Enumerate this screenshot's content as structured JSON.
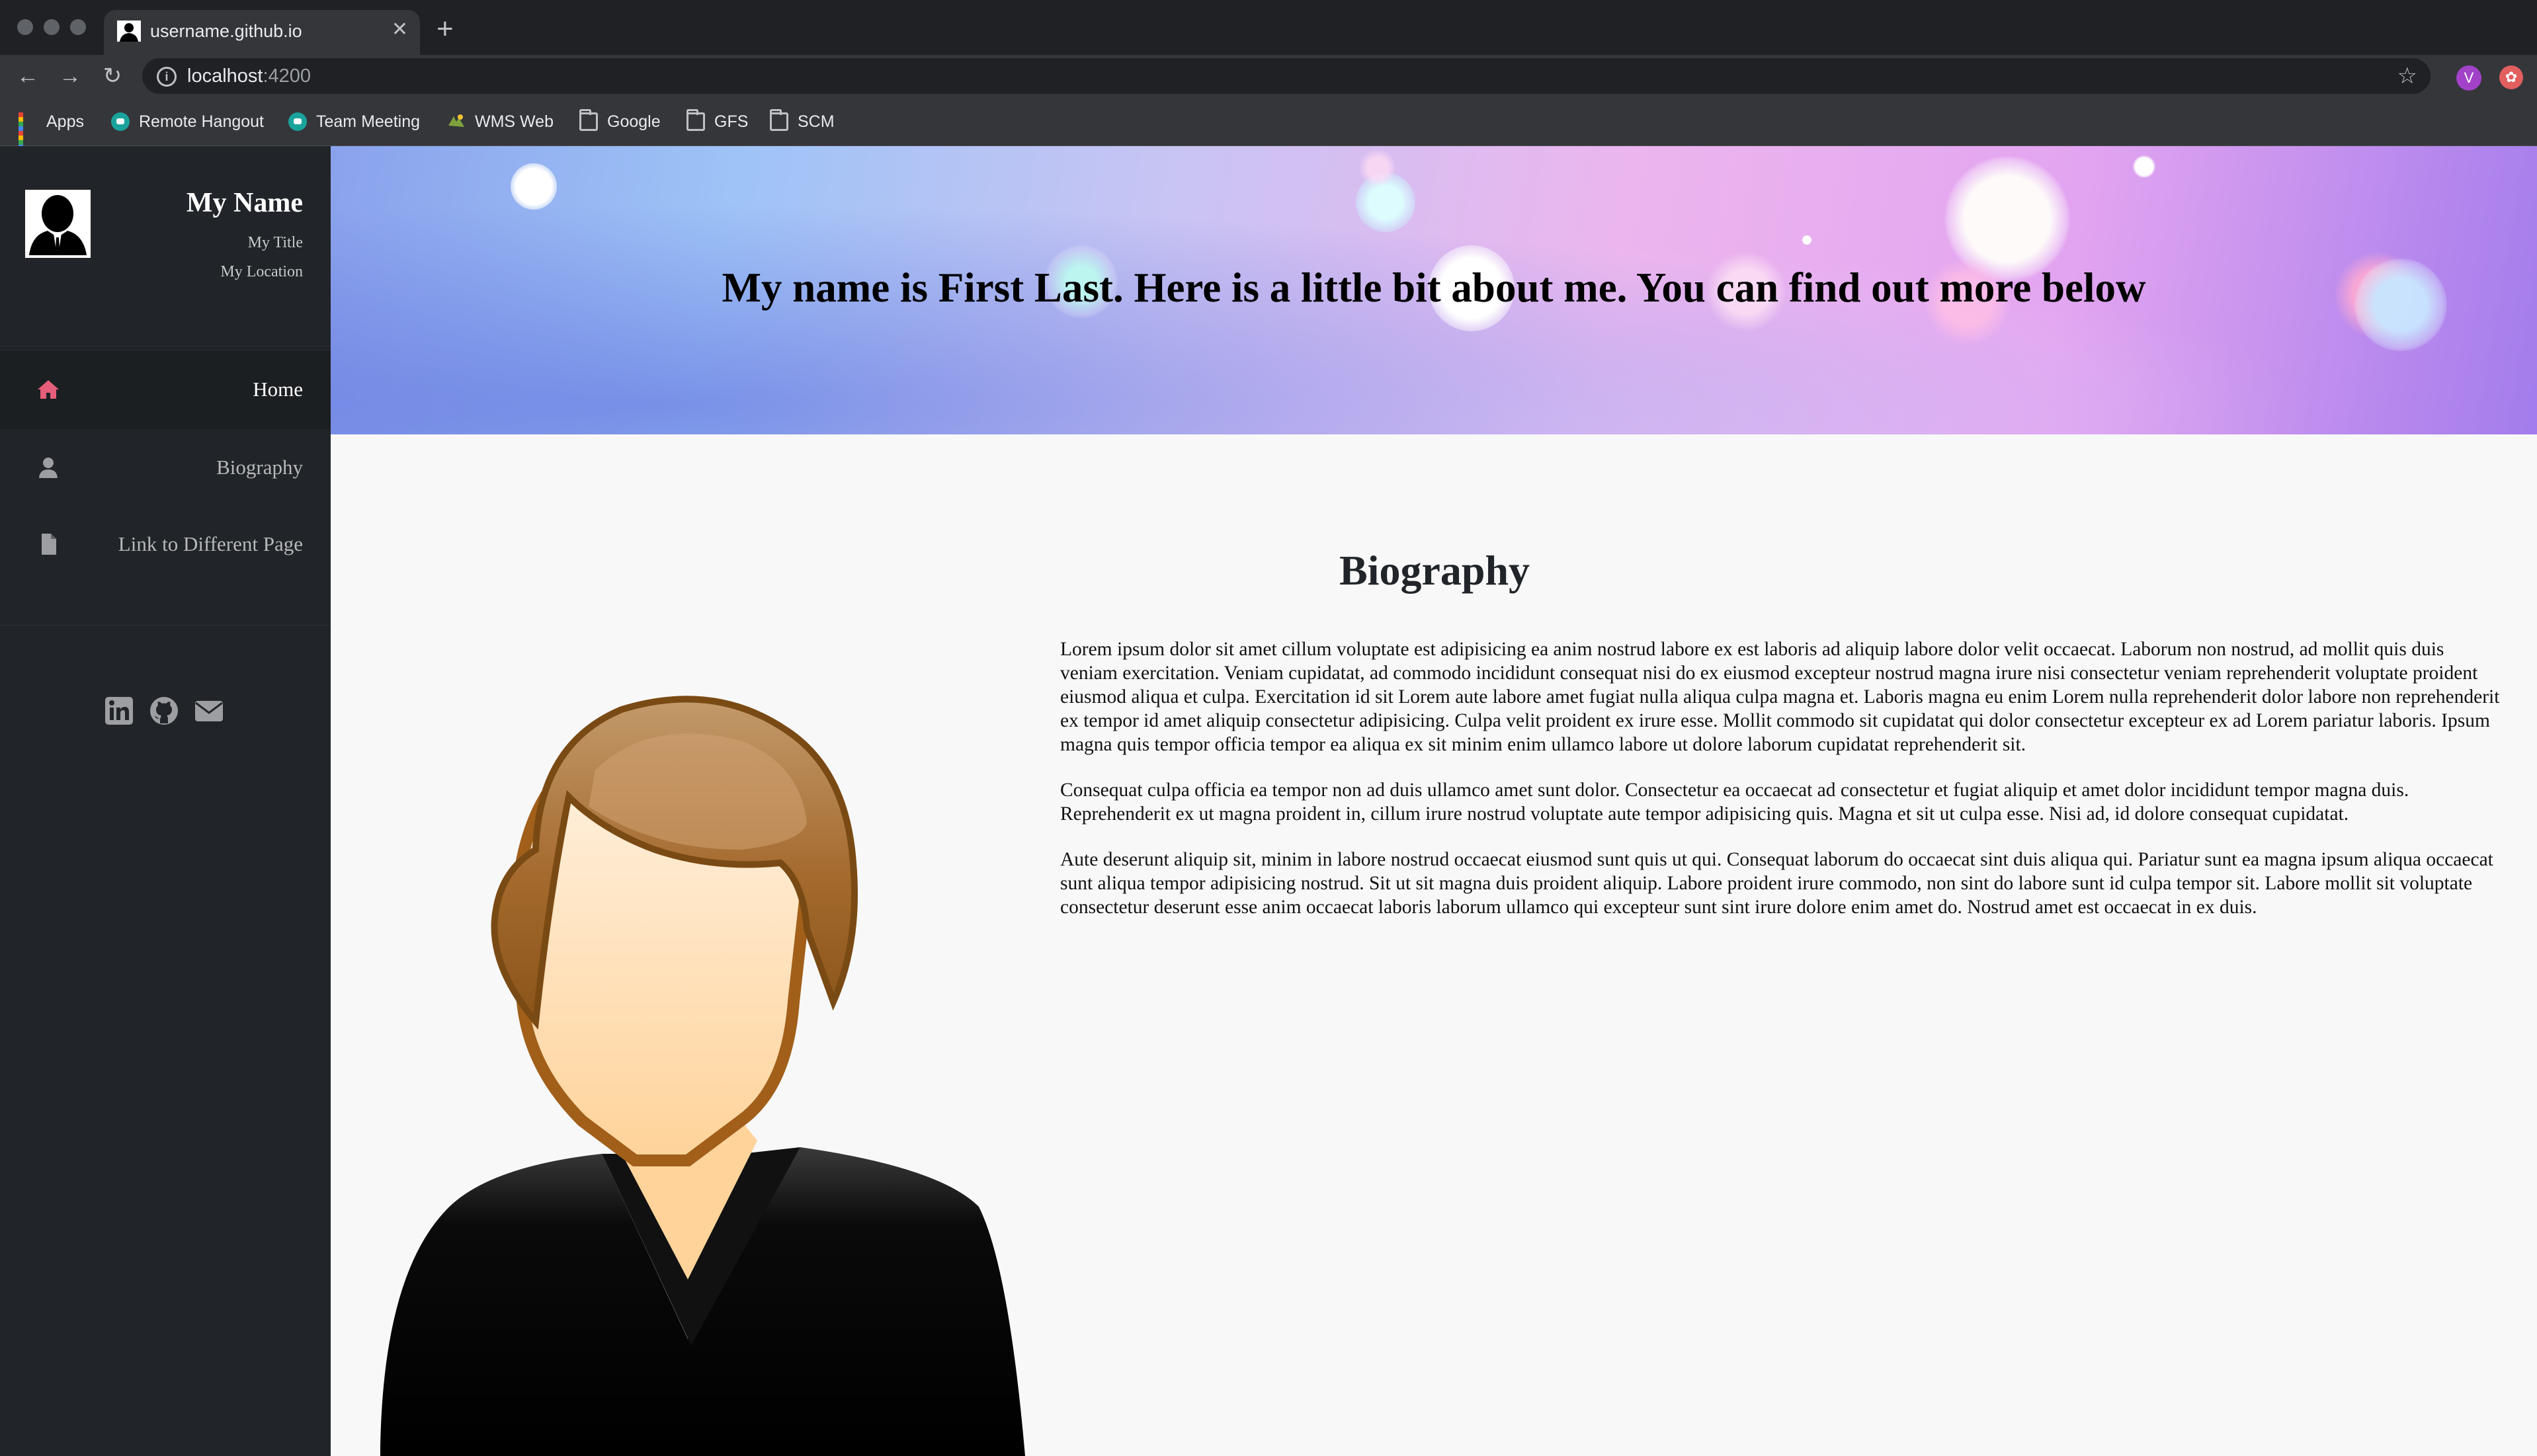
{
  "browser": {
    "tab_title": "username.github.io",
    "url_host": "localhost",
    "url_port": ":4200",
    "bookmarks": [
      {
        "label": "Apps",
        "icon": "apps-grid-icon"
      },
      {
        "label": "Remote Hangout",
        "icon": "hangouts-icon"
      },
      {
        "label": "Team Meeting",
        "icon": "hangouts-icon"
      },
      {
        "label": "WMS Web",
        "icon": "wms-icon"
      },
      {
        "label": "Google",
        "icon": "folder-icon"
      },
      {
        "label": "GFS",
        "icon": "folder-icon"
      },
      {
        "label": "SCM",
        "icon": "folder-icon"
      }
    ],
    "profile_initial": "V"
  },
  "sidebar": {
    "name": "My Name",
    "title": "My Title",
    "location": "My Location",
    "nav": [
      {
        "label": "Home",
        "icon": "home-icon",
        "active": true
      },
      {
        "label": "Biography",
        "icon": "user-icon",
        "active": false
      },
      {
        "label": "Link to Different Page",
        "icon": "file-icon",
        "active": false
      }
    ],
    "social": [
      "linkedin-icon",
      "github-icon",
      "envelope-icon"
    ]
  },
  "hero": {
    "headline": "My name is First Last. Here is a little bit about me. You can find out more below"
  },
  "biography": {
    "heading": "Biography",
    "paragraphs": [
      "Lorem ipsum dolor sit amet cillum voluptate est adipisicing ea anim nostrud labore ex est laboris ad aliquip labore dolor velit occaecat. Laborum non nostrud, ad mollit quis duis veniam exercitation. Veniam cupidatat, ad commodo incididunt consequat nisi do ex eiusmod excepteur nostrud magna irure nisi consectetur veniam reprehenderit voluptate proident eiusmod aliqua et culpa. Exercitation id sit Lorem aute labore amet fugiat nulla aliqua culpa magna et. Laboris magna eu enim Lorem nulla reprehenderit dolor labore non reprehenderit ex tempor id amet aliquip consectetur adipisicing. Culpa velit proident ex irure esse. Mollit commodo sit cupidatat qui dolor consectetur excepteur ex ad Lorem pariatur laboris. Ipsum magna quis tempor officia tempor ea aliqua ex sit minim enim ullamco labore ut dolore laborum cupidatat reprehenderit sit.",
      "Consequat culpa officia ea tempor non ad duis ullamco amet sunt dolor. Consectetur ea occaecat ad consectetur et fugiat aliquip et amet dolor incididunt tempor magna duis. Reprehenderit ex ut magna proident in, cillum irure nostrud voluptate aute tempor adipisicing quis. Magna et sit ut culpa esse. Nisi ad, id dolore consequat cupidatat.",
      "Aute deserunt aliquip sit, minim in labore nostrud occaecat eiusmod sunt quis ut qui. Consequat laborum do occaecat sint duis aliqua qui. Pariatur sunt ea magna ipsum aliqua occaecat sunt aliqua tempor adipisicing nostrud. Sit ut sit magna duis proident aliquip. Labore proident irure commodo, non sint do labore sunt id culpa tempor sit. Labore mollit sit voluptate consectetur deserunt esse anim occaecat laboris laborum ullamco qui excepteur sunt sint irure dolore enim amet do. Nostrud amet est occaecat in ex duis."
    ]
  },
  "colors": {
    "sidebar_bg": "#212529",
    "active_icon": "#e55f7a",
    "page_bg": "#f8f8f8"
  }
}
